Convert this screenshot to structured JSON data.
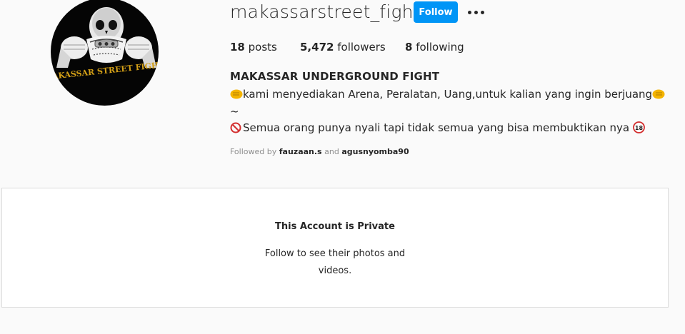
{
  "profile": {
    "username": "makassarstreet_fight",
    "follow_label": "Follow",
    "more_icon": "ellipsis-icon",
    "avatar_text": "MAKASSAR STREET FIGHT"
  },
  "stats": {
    "posts_count": "18",
    "posts_label": "posts",
    "followers_count": "5,472",
    "followers_label": "followers",
    "following_count": "8",
    "following_label": "following"
  },
  "bio": {
    "full_name": "MAKASSAR UNDERGROUND FIGHT",
    "line1_text": "kami menyediakan Arena, Peralatan, Uang,untuk kalian yang ingin berjuang",
    "line2_text": "~",
    "line3_text": "Semua orang punya nyali tapi tidak semua yang bisa membuktikan nya",
    "icons": [
      "fist-icon",
      "no-entry-icon",
      "eighteen-plus-icon"
    ]
  },
  "followed_by": {
    "prefix": "Followed by",
    "user1": "fauzaan.s",
    "conjunction": "and",
    "user2": "agusnyomba90"
  },
  "private_notice": {
    "title": "This Account is Private",
    "message": "Follow to see their photos and videos."
  },
  "colors": {
    "accent": "#0095f6",
    "background": "#fafafa",
    "muted": "#8e8e8e",
    "avatar_text": "#d4a017"
  }
}
